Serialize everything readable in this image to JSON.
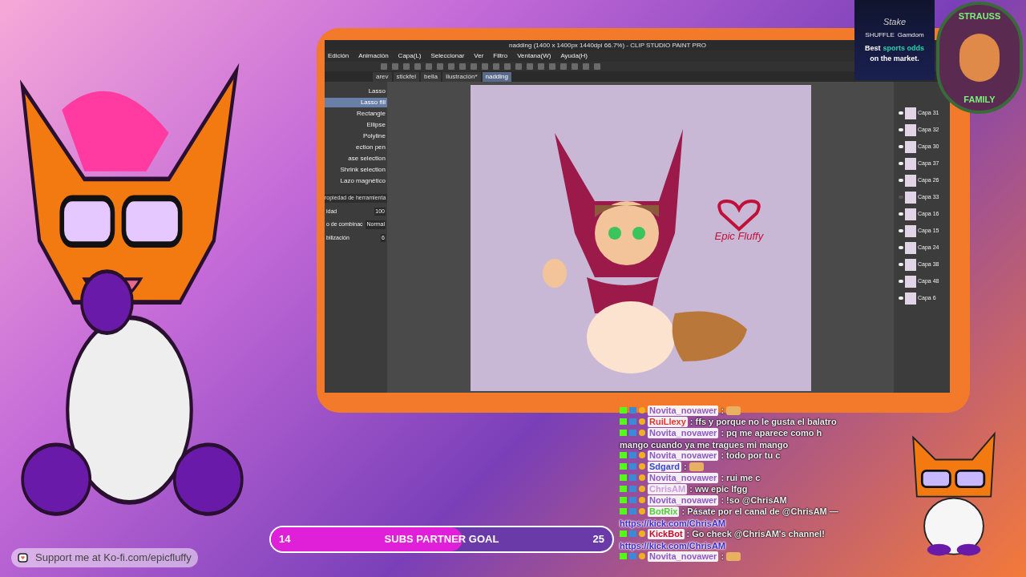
{
  "app_window": {
    "title": "nadding (1400 x 1400px 1440dpi 66.7%) - CLIP STUDIO PAINT PRO",
    "menu": [
      "Edición",
      "Animación",
      "Capa(L)",
      "Seleccionar",
      "Ver",
      "Filtro",
      "Ventana(W)",
      "Ayuda(H)"
    ],
    "tabs": [
      {
        "label": "arev",
        "selected": false
      },
      {
        "label": "stickfel",
        "selected": false
      },
      {
        "label": "bella",
        "selected": false
      },
      {
        "label": "Ilustración*",
        "selected": false
      },
      {
        "label": "nadding",
        "selected": true
      }
    ],
    "tools": [
      {
        "label": "Lasso",
        "selected": false
      },
      {
        "label": "Lasso fill",
        "selected": true
      },
      {
        "label": "Rectangle",
        "selected": false
      },
      {
        "label": "Ellipse",
        "selected": false
      },
      {
        "label": "Polyline",
        "selected": false
      },
      {
        "label": "ection pen",
        "selected": false
      },
      {
        "label": "ase selection",
        "selected": false
      },
      {
        "label": "Shrink selection",
        "selected": false
      },
      {
        "label": "Lazo magnético",
        "selected": false
      }
    ],
    "tool_property": {
      "title": "ropiedad de herramienta",
      "rows": [
        {
          "label": "idad",
          "value": "100"
        },
        {
          "label": "o de combinac",
          "value": "Normal"
        },
        {
          "label": "bilización",
          "value": "6"
        }
      ]
    },
    "canvas": {
      "logo_text": "Epic Fluffy"
    },
    "layers": [
      {
        "name": "Capa 31",
        "visible": true
      },
      {
        "name": "Capa 32",
        "visible": true
      },
      {
        "name": "Capa 30",
        "visible": true
      },
      {
        "name": "Capa 37",
        "visible": true
      },
      {
        "name": "Capa 26",
        "visible": true
      },
      {
        "name": "Capa 33",
        "visible": false
      },
      {
        "name": "Capa 16",
        "visible": true
      },
      {
        "name": "Capa 15",
        "visible": true
      },
      {
        "name": "Capa 24",
        "visible": true
      },
      {
        "name": "Capa 38",
        "visible": true
      },
      {
        "name": "Capa 48",
        "visible": true
      },
      {
        "name": "Capa 6",
        "visible": true
      }
    ]
  },
  "ad": {
    "brand": "Stake",
    "brands": [
      "SHUFFLE",
      "Gamdom"
    ],
    "headline": [
      {
        "text": "Best",
        "accent": false
      },
      {
        "text": "sports odds",
        "accent": true
      },
      {
        "text": "on the market.",
        "accent": false
      }
    ]
  },
  "badge": {
    "top": "STRAUSS",
    "bottom": "FAMILY"
  },
  "chat": [
    {
      "user": "Novita_novawer",
      "color": "#8a5cc4",
      "text": ":",
      "emote": true
    },
    {
      "user": "RuiLlexy",
      "color": "#e03a2a",
      "text": ": ffs y porque no le gusta el balatro",
      "emote": false
    },
    {
      "user": "Novita_novawer",
      "color": "#8a5cc4",
      "text": ": pq me aparece como h",
      "continuation": "mango cuando ya me tragues mi mango",
      "emote": false
    },
    {
      "user": "Novita_novawer",
      "color": "#8a5cc4",
      "text": ": todo por tu c",
      "emote": false
    },
    {
      "user": "Sdgard",
      "color": "#3a4ac4",
      "text": ":",
      "emote": true
    },
    {
      "user": "Novita_novawer",
      "color": "#8a5cc4",
      "text": ": rui me c",
      "emote": false
    },
    {
      "user": "ChrisAM",
      "color": "#c8a0e0",
      "text": ": ww epic lfgg",
      "emote": false
    },
    {
      "user": "Novita_novawer",
      "color": "#8a5cc4",
      "text": ": !so @ChrisAM",
      "emote": false
    },
    {
      "user": "BotRix",
      "color": "#4cd137",
      "text": ": Pásate por el canal de @ChrisAM —",
      "link": "https://kick.com/ChrisAM",
      "emote": false
    },
    {
      "user": "KickBot",
      "color": "#c0102a",
      "text": ": Go check @ChrisAM's channel!",
      "link": "https://kick.com/ChrisAM",
      "emote": false
    },
    {
      "user": "Novita_novawer",
      "color": "#8a5cc4",
      "text": ":",
      "emote": true
    }
  ],
  "goal": {
    "start": "14",
    "label": "SUBS PARTNER GOAL",
    "end": "25",
    "level": 0.56
  },
  "kofi": {
    "text": "Support me at Ko-fi.com/epicfluffy"
  }
}
